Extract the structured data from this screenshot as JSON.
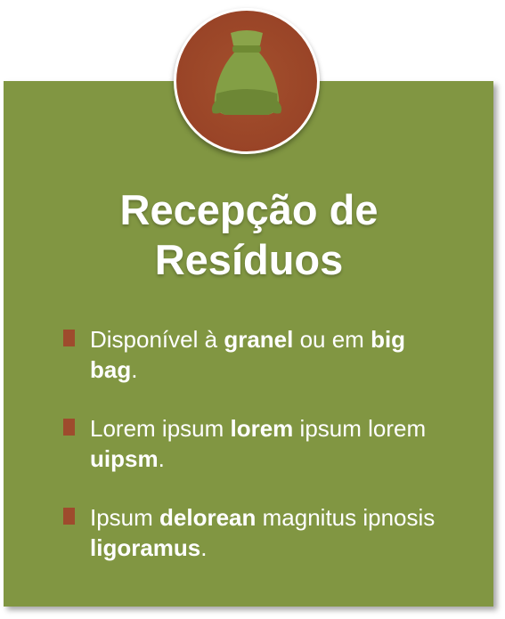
{
  "icon": "sack-icon",
  "title_line1": "Recepção de",
  "title_line2": "Resíduos",
  "items": [
    {
      "parts": [
        "Disponível à ",
        "granel",
        " ou em ",
        "big bag",
        "."
      ]
    },
    {
      "parts": [
        "Lorem ipsum ",
        "lorem",
        " ipsum lorem ",
        "uipsm",
        "."
      ]
    },
    {
      "parts": [
        "Ipsum ",
        "delorean",
        " magnitus ipnosis ",
        "ligoramus",
        "."
      ]
    }
  ],
  "colors": {
    "card": "#819642",
    "badge": "#9a4628",
    "bullet": "#9e4b2d",
    "sack": "#7c9a3d"
  }
}
